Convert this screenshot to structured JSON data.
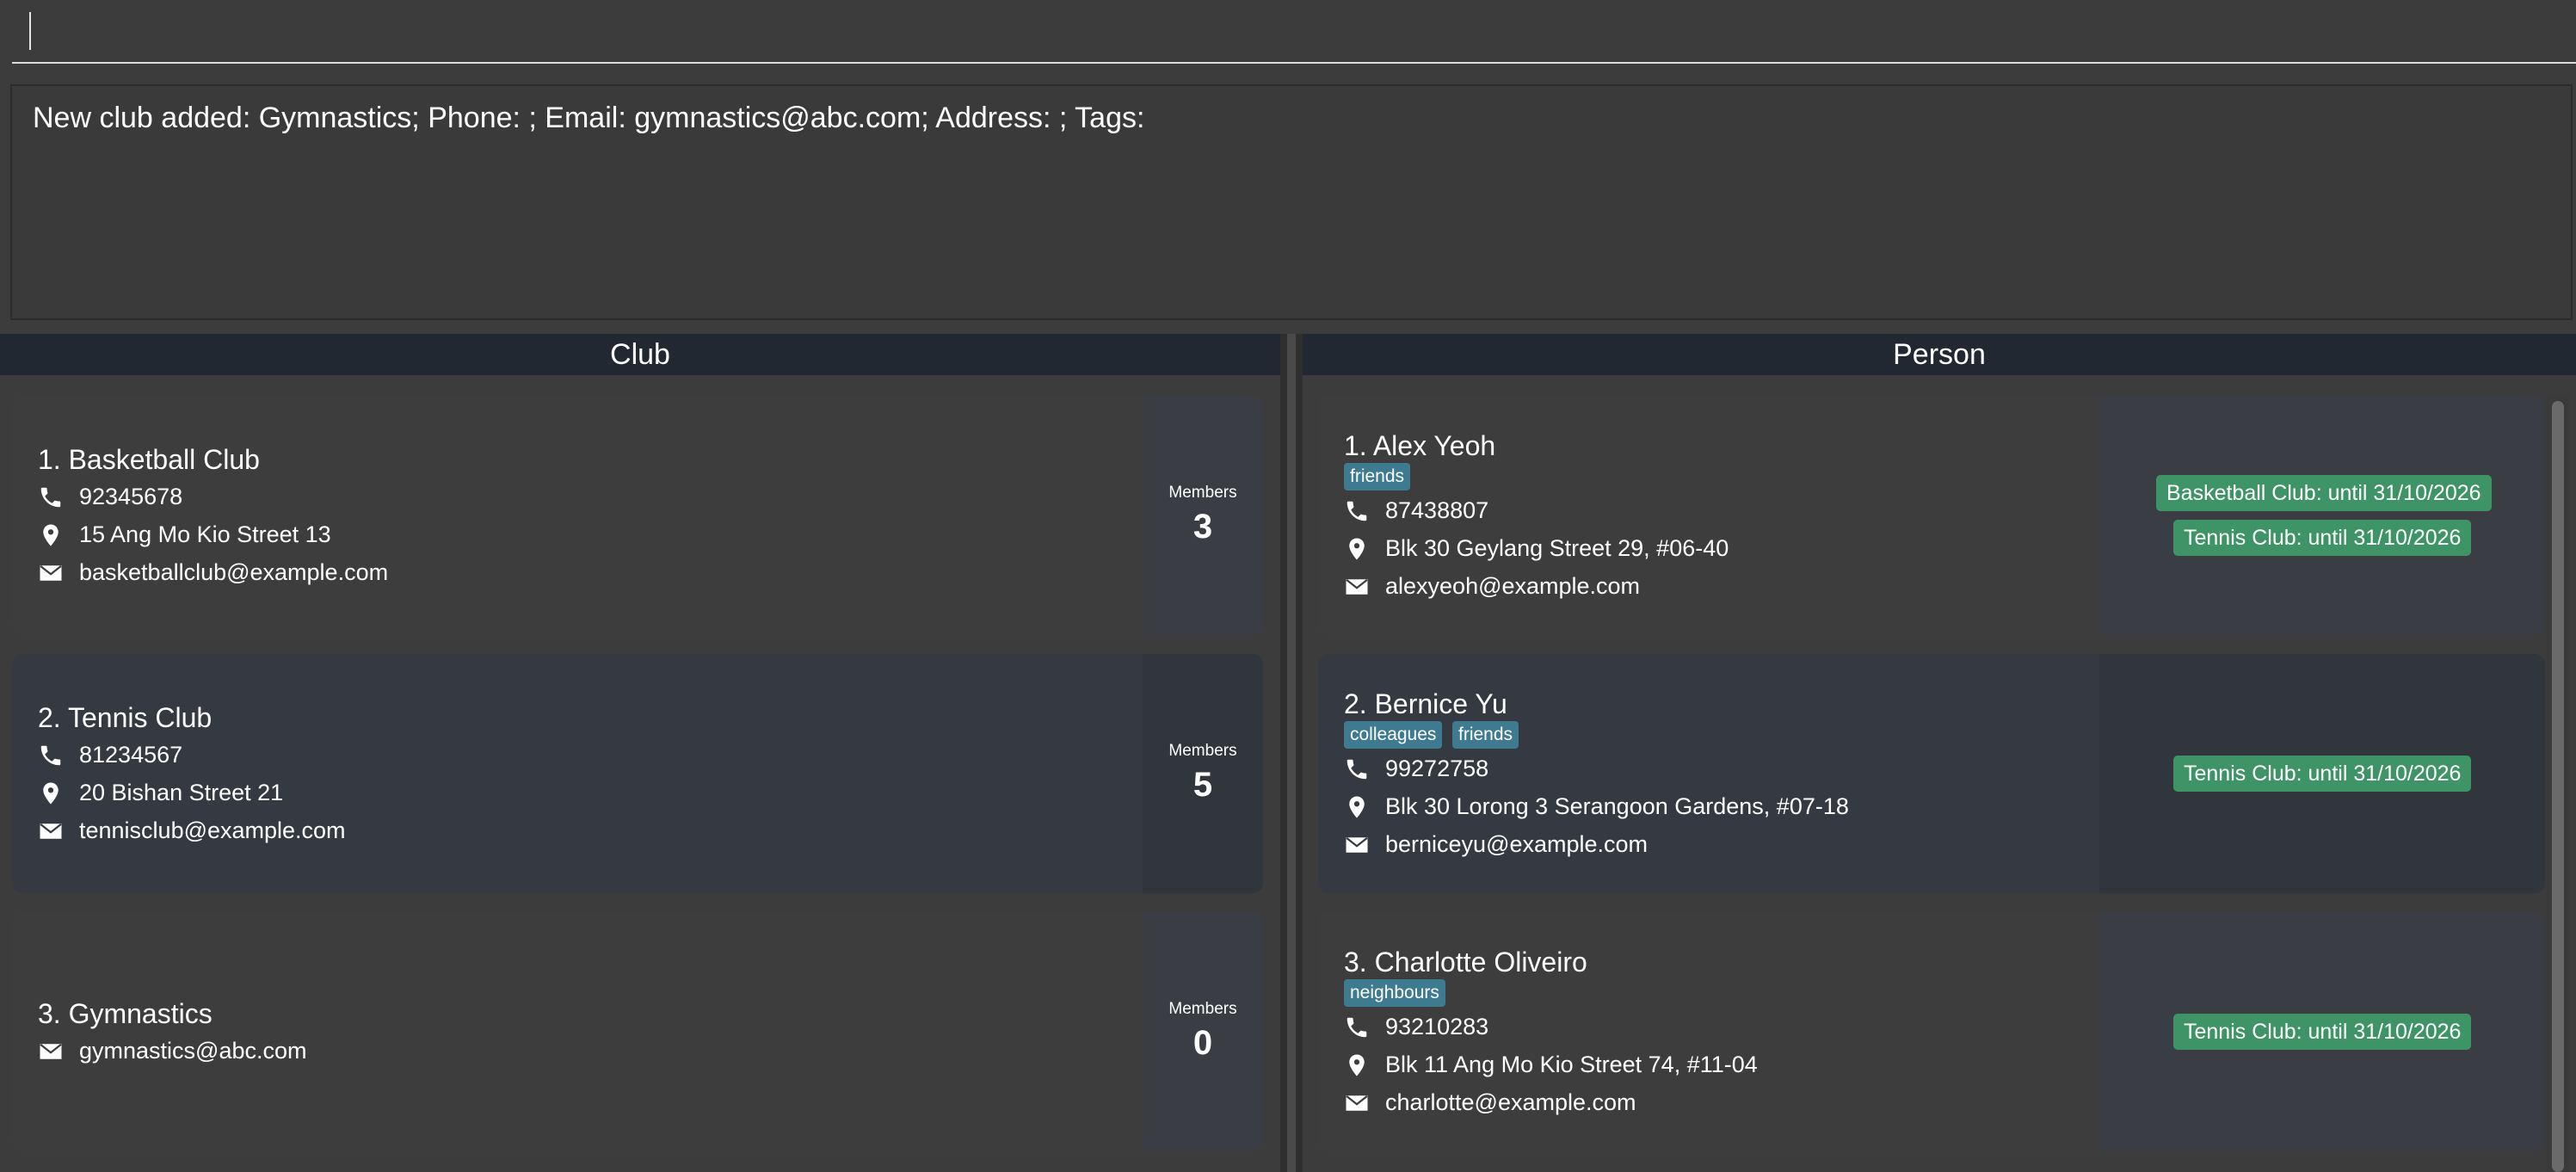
{
  "command": {
    "value": ""
  },
  "result": {
    "text": "New club added: Gymnastics; Phone: ; Email: gymnastics@abc.com; Address: ; Tags:"
  },
  "panels": {
    "club_title": "Club",
    "person_title": "Person"
  },
  "clubs": [
    {
      "index_name": "1. Basketball Club",
      "phone": "92345678",
      "address": "15 Ang Mo Kio Street 13",
      "email": "basketballclub@example.com",
      "members_label": "Members",
      "members": "3"
    },
    {
      "index_name": "2. Tennis Club",
      "phone": "81234567",
      "address": "20 Bishan Street 21",
      "email": "tennisclub@example.com",
      "members_label": "Members",
      "members": "5"
    },
    {
      "index_name": "3. Gymnastics",
      "email": "gymnastics@abc.com",
      "members_label": "Members",
      "members": "0"
    }
  ],
  "persons": [
    {
      "index_name": "1. Alex Yeoh",
      "tags": [
        "friends"
      ],
      "phone": "87438807",
      "address": "Blk 30 Geylang Street 29, #06-40",
      "email": "alexyeoh@example.com",
      "memberships": [
        "Basketball Club: until 31/10/2026",
        "Tennis Club: until 31/10/2026"
      ]
    },
    {
      "index_name": "2. Bernice Yu",
      "tags": [
        "colleagues",
        "friends"
      ],
      "phone": "99272758",
      "address": "Blk 30 Lorong 3 Serangoon Gardens, #07-18",
      "email": "berniceyu@example.com",
      "memberships": [
        "Tennis Club: until 31/10/2026"
      ]
    },
    {
      "index_name": "3. Charlotte Oliveiro",
      "tags": [
        "neighbours"
      ],
      "phone": "93210283",
      "address": "Blk 11 Ang Mo Kio Street 74, #11-04",
      "email": "charlotte@example.com",
      "memberships": [
        "Tennis Club: until 31/10/2026"
      ]
    }
  ],
  "icons": {
    "phone": "phone-icon",
    "address": "location-pin-icon",
    "email": "envelope-icon"
  },
  "colors": {
    "tag": "#3e7b91",
    "membership": "#3e9466",
    "header": "#222831"
  }
}
